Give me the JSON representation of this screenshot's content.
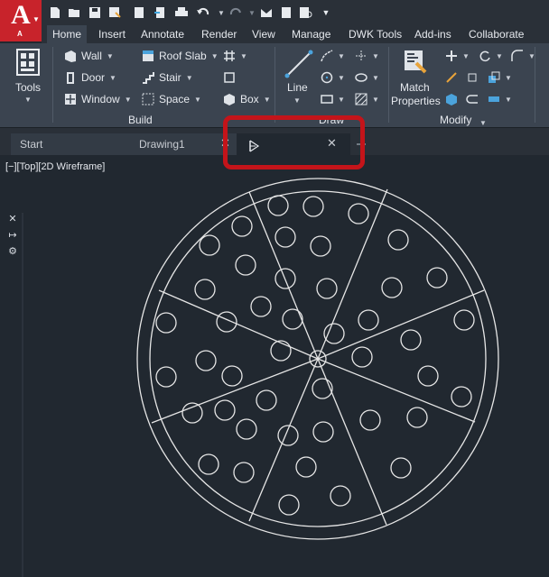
{
  "app_button": {
    "letter": "A",
    "sub_letter": "A",
    "menu_icon": "caret-down-icon"
  },
  "quick_access": [
    "new-icon",
    "open-icon",
    "save-icon",
    "save-as-icon",
    "print-preview-icon",
    "export-icon",
    "print-icon",
    "undo-icon",
    "redo-icon",
    "share-icon",
    "sheet-icon",
    "plot-icon",
    "customize-icon"
  ],
  "ribbon_tabs": [
    {
      "label": "Home",
      "active": true
    },
    {
      "label": "Insert"
    },
    {
      "label": "Annotate"
    },
    {
      "label": "Render"
    },
    {
      "label": "View"
    },
    {
      "label": "Manage"
    },
    {
      "label": "DWK Tools"
    },
    {
      "label": "Add-ins"
    },
    {
      "label": "Collaborate"
    }
  ],
  "ribbon": {
    "tools": {
      "label": "Tools"
    },
    "build": {
      "panel_label": "Build",
      "wall": "Wall",
      "door": "Door",
      "window": "Window",
      "roof_slab": "Roof Slab",
      "stair": "Stair",
      "space": "Space",
      "box": "Box"
    },
    "draw": {
      "panel_label": "Draw",
      "line": "Line"
    },
    "modify": {
      "panel_label": "Modify",
      "match_line1": "Match",
      "match_line2": "Properties"
    }
  },
  "file_tabs": [
    {
      "label": "Start"
    },
    {
      "label": "Drawing1"
    },
    {
      "label": "",
      "active": true
    }
  ],
  "viewport_label": "[−][Top][2D Wireframe]",
  "colors": {
    "highlight": "#c4141a",
    "app_red": "#c8232b",
    "canvas_bg": "#212830",
    "linework": "#e6e6e6"
  }
}
